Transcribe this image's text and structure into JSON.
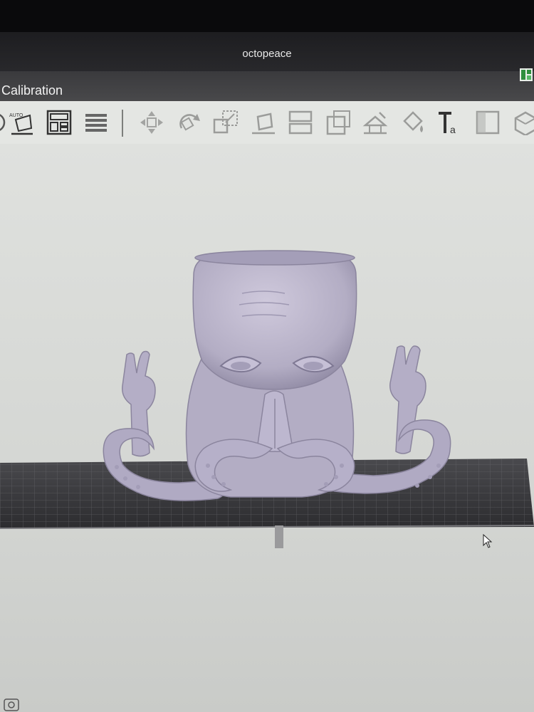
{
  "window": {
    "title": "octopeace"
  },
  "menubar": {
    "tab_label": "Calibration"
  },
  "toolbar": {
    "auto_label": "AUTO",
    "text_tool_glyph": "Ta",
    "tools": [
      {
        "icon": "auto-orient-icon"
      },
      {
        "icon": "arrange-icon"
      },
      {
        "icon": "layers-list-icon"
      },
      {
        "icon": "move-icon"
      },
      {
        "icon": "rotate-icon"
      },
      {
        "icon": "scale-icon"
      },
      {
        "icon": "lay-on-face-icon"
      },
      {
        "icon": "split-icon"
      },
      {
        "icon": "cut-icon"
      },
      {
        "icon": "support-paint-icon"
      },
      {
        "icon": "color-paint-icon"
      },
      {
        "icon": "text-icon"
      },
      {
        "icon": "seam-icon"
      },
      {
        "icon": "cube-icon"
      }
    ]
  },
  "colors": {
    "model": "#b9b3c8",
    "model_shade": "#8f88a3",
    "plate": "#3a3a3d",
    "viewport": "#dcdedb"
  }
}
